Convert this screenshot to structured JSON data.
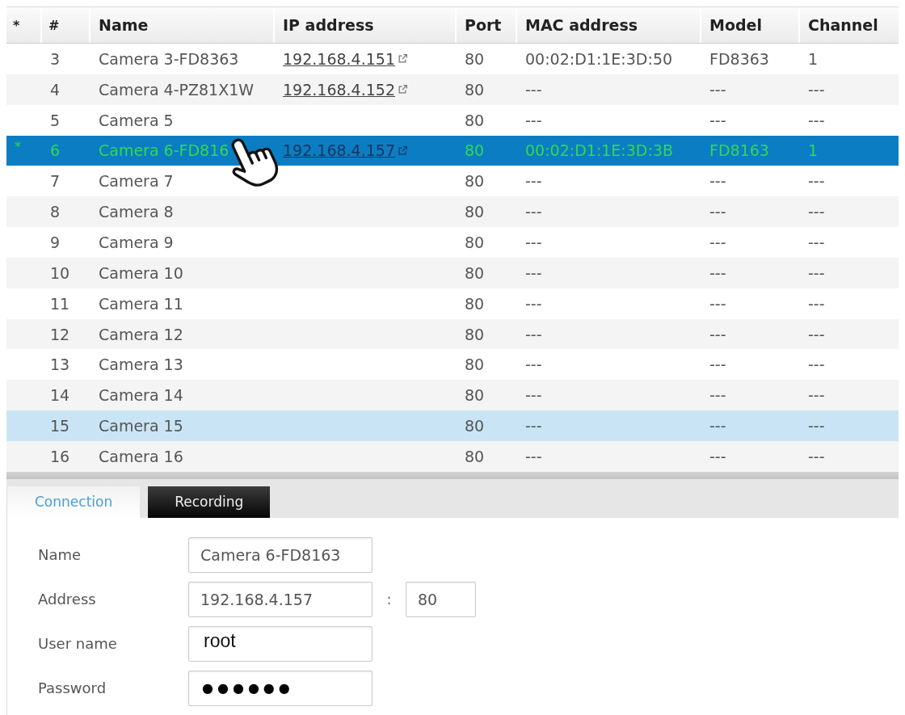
{
  "table": {
    "columns": [
      "*",
      "#",
      "Name",
      "IP address",
      "Port",
      "MAC address",
      "Model",
      "Channel"
    ],
    "rows": [
      {
        "number": "3",
        "name": "Camera 3-FD8363",
        "ip": "192.168.4.151",
        "port": "80",
        "mac": "00:02:D1:1E:3D:50",
        "model": "FD8363",
        "channel": "1",
        "selected": false,
        "highlighted": false
      },
      {
        "number": "4",
        "name": "Camera 4-PZ81X1W",
        "ip": "192.168.4.152",
        "port": "80",
        "mac": "---",
        "model": "---",
        "channel": "---",
        "selected": false,
        "highlighted": false
      },
      {
        "number": "5",
        "name": "Camera 5",
        "port": "80",
        "mac": "---",
        "model": "---",
        "channel": "---",
        "selected": false,
        "highlighted": false
      },
      {
        "marker": "*",
        "number": "6",
        "name": "Camera 6-FD816",
        "ip": "192.168.4.157",
        "port": "80",
        "mac": "00:02:D1:1E:3D:3B",
        "model": "FD8163",
        "channel": "1",
        "selected": true,
        "highlighted": false
      },
      {
        "number": "7",
        "name": "Camera 7",
        "port": "80",
        "mac": "---",
        "model": "---",
        "channel": "---",
        "selected": false,
        "highlighted": false
      },
      {
        "number": "8",
        "name": "Camera 8",
        "port": "80",
        "mac": "---",
        "model": "---",
        "channel": "---",
        "selected": false,
        "highlighted": false
      },
      {
        "number": "9",
        "name": "Camera 9",
        "port": "80",
        "mac": "---",
        "model": "---",
        "channel": "---",
        "selected": false,
        "highlighted": false
      },
      {
        "number": "10",
        "name": "Camera 10",
        "port": "80",
        "mac": "---",
        "model": "---",
        "channel": "---",
        "selected": false,
        "highlighted": false
      },
      {
        "number": "11",
        "name": "Camera 11",
        "port": "80",
        "mac": "---",
        "model": "---",
        "channel": "---",
        "selected": false,
        "highlighted": false
      },
      {
        "number": "12",
        "name": "Camera 12",
        "port": "80",
        "mac": "---",
        "model": "---",
        "channel": "---",
        "selected": false,
        "highlighted": false
      },
      {
        "number": "13",
        "name": "Camera 13",
        "port": "80",
        "mac": "---",
        "model": "---",
        "channel": "---",
        "selected": false,
        "highlighted": false
      },
      {
        "number": "14",
        "name": "Camera 14",
        "port": "80",
        "mac": "---",
        "model": "---",
        "channel": "---",
        "selected": false,
        "highlighted": false
      },
      {
        "number": "15",
        "name": "Camera 15",
        "port": "80",
        "mac": "---",
        "model": "---",
        "channel": "---",
        "selected": false,
        "highlighted": true
      },
      {
        "number": "16",
        "name": "Camera 16",
        "port": "80",
        "mac": "---",
        "model": "---",
        "channel": "---",
        "selected": false,
        "highlighted": false
      }
    ]
  },
  "tabs": [
    {
      "label": "Connection",
      "selected": true
    },
    {
      "label": "Recording",
      "selected": false
    }
  ],
  "form": {
    "fields": [
      {
        "label": "Name",
        "kind": "text",
        "value": "Camera 6-FD8163"
      },
      {
        "label": "Address",
        "kind": "text",
        "value": "192.168.4.157",
        "separator": ":",
        "port": "80"
      },
      {
        "label": "User name",
        "kind": "text",
        "value": "root"
      },
      {
        "label": "Password",
        "kind": "password",
        "value": "●●●●●●"
      }
    ]
  }
}
